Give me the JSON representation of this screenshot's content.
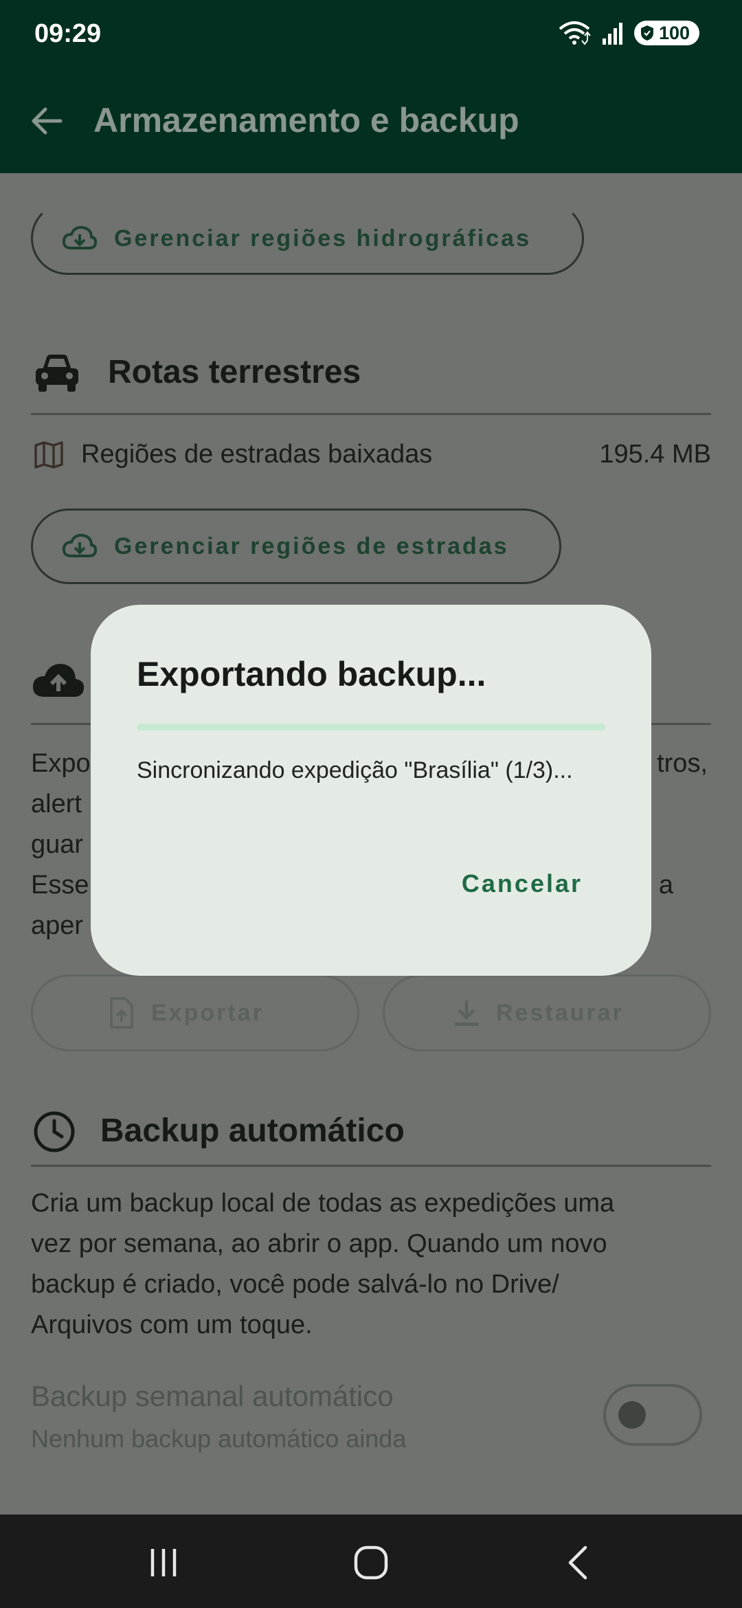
{
  "status_bar": {
    "time": "09:29",
    "battery": "100",
    "icons": [
      "wifi-icon",
      "signal-icon",
      "battery-shield-icon"
    ]
  },
  "app_bar": {
    "title": "Armazenamento e backup",
    "back_icon": "arrow-left-icon"
  },
  "hydro": {
    "manage_button": "Gerenciar regiões hidrográficas"
  },
  "roads": {
    "title": "Rotas terrestres",
    "downloaded_label": "Regiões de estradas baixadas",
    "downloaded_size": "195.4 MB",
    "manage_button": "Gerenciar regiões de estradas"
  },
  "backup": {
    "text_visible": [
      {
        "left": "Expo",
        "right": "tros,"
      },
      {
        "left": "alert",
        "right": ""
      },
      {
        "left": "guar",
        "right": ""
      },
      {
        "left": "Esse",
        "right": "a"
      },
      {
        "left": "aper",
        "right": ""
      }
    ],
    "export_button": "Exportar",
    "restore_button": "Restaurar"
  },
  "auto_backup": {
    "title": "Backup automático",
    "description_lines": [
      "Cria um backup local de todas as expedições uma",
      "vez por semana, ao abrir o app. Quando um novo",
      "backup é criado, você pode salvá-lo no Drive/",
      "Arquivos com um toque."
    ],
    "toggle_label": "Backup semanal automático",
    "toggle_sub": "Nenhum backup automático ainda",
    "toggle_on": false
  },
  "dialog": {
    "title": "Exportando backup...",
    "message": "Sincronizando expedição \"Brasília\" (1/3)...",
    "progress": 1.0,
    "cancel_label": "Cancelar"
  },
  "colors": {
    "accent": "#1f6a45",
    "app_bar": "#022f1f",
    "dialog_bg": "#e4ebe4",
    "progress": "#c6ead1"
  }
}
